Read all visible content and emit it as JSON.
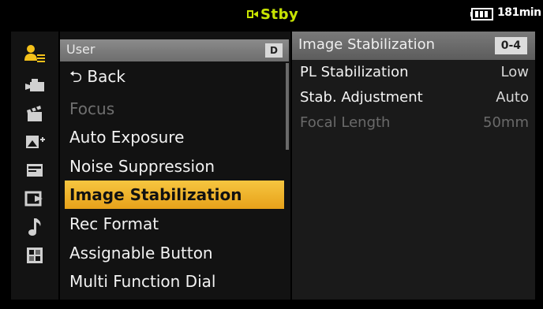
{
  "status": {
    "mode": "Stby",
    "battery_text": "181min"
  },
  "menu": {
    "header": {
      "label": "User",
      "badge": "D"
    },
    "items": [
      {
        "label": "⮌ Back",
        "state": "normal"
      },
      {
        "label": "Focus",
        "state": "disabled"
      },
      {
        "label": "Auto Exposure",
        "state": "normal"
      },
      {
        "label": "Noise Suppression",
        "state": "normal"
      },
      {
        "label": "Image Stabilization",
        "state": "selected"
      },
      {
        "label": "Rec Format",
        "state": "normal"
      },
      {
        "label": "Assignable Button",
        "state": "normal"
      },
      {
        "label": "Multi Function Dial",
        "state": "normal"
      }
    ]
  },
  "detail": {
    "title": "Image Stabilization",
    "badge": "0-4",
    "rows": [
      {
        "label": "PL Stabilization",
        "value": "Low",
        "state": "normal"
      },
      {
        "label": "Stab. Adjustment",
        "value": "Auto",
        "state": "normal"
      },
      {
        "label": "Focal Length",
        "value": "50mm",
        "state": "disabled"
      }
    ]
  },
  "icons": [
    "user-menu-icon",
    "camera-icon",
    "clapperboard-icon",
    "image-edit-icon",
    "media-card-icon",
    "output-icon",
    "audio-note-icon",
    "setup-grid-icon"
  ],
  "colors": {
    "accent": "#f0b52e",
    "stby": "#c8e400",
    "user_icon": "#f4c11a"
  }
}
